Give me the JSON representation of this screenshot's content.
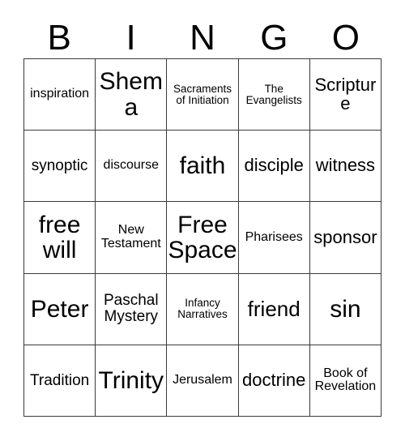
{
  "header": {
    "letters": [
      "B",
      "I",
      "N",
      "G",
      "O"
    ]
  },
  "card": {
    "columns": 5,
    "rows": 5,
    "free_space_label": "Free Space",
    "cells": [
      {
        "text": "inspiration",
        "size": "fs-sm"
      },
      {
        "text": "Shema",
        "size": "fs-xxl"
      },
      {
        "text": "Sacraments of Initiation",
        "size": "fs-xs"
      },
      {
        "text": "The Evangelists",
        "size": "fs-xs"
      },
      {
        "text": "Scripture",
        "size": "fs-lg"
      },
      {
        "text": "synoptic",
        "size": "fs-md"
      },
      {
        "text": "discourse",
        "size": "fs-sm"
      },
      {
        "text": "faith",
        "size": "fs-xxl"
      },
      {
        "text": "disciple",
        "size": "fs-lg"
      },
      {
        "text": "witness",
        "size": "fs-lg"
      },
      {
        "text": "free will",
        "size": "fs-xxl"
      },
      {
        "text": "New Testament",
        "size": "fs-sm"
      },
      {
        "text": "Free Space",
        "size": "fs-xxl"
      },
      {
        "text": "Pharisees",
        "size": "fs-sm"
      },
      {
        "text": "sponsor",
        "size": "fs-lg"
      },
      {
        "text": "Peter",
        "size": "fs-xxl"
      },
      {
        "text": "Paschal Mystery",
        "size": "fs-md"
      },
      {
        "text": "Infancy Narratives",
        "size": "fs-xs"
      },
      {
        "text": "friend",
        "size": "fs-xl"
      },
      {
        "text": "sin",
        "size": "fs-xxl"
      },
      {
        "text": "Tradition",
        "size": "fs-md"
      },
      {
        "text": "Trinity",
        "size": "fs-xxl"
      },
      {
        "text": "Jerusalem",
        "size": "fs-sm"
      },
      {
        "text": "doctrine",
        "size": "fs-lg"
      },
      {
        "text": "Book of Revelation",
        "size": "fs-sm"
      }
    ]
  },
  "colors": {
    "background": "#ffffff",
    "border": "#3a3a3a",
    "text": "#000000"
  }
}
